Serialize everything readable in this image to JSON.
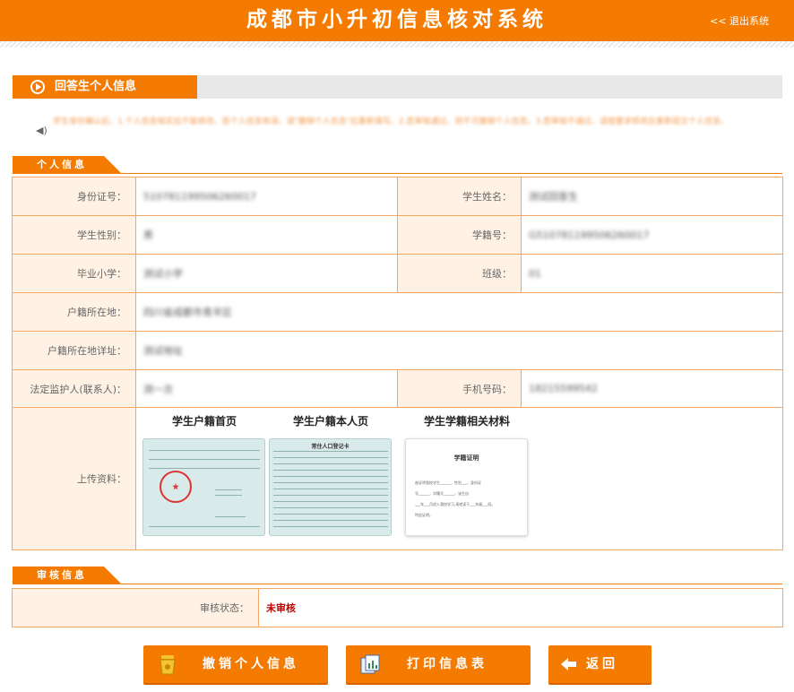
{
  "header": {
    "title": "成都市小升初信息核对系统",
    "logout": "<< 退出系统"
  },
  "section": {
    "title": "回答生个人信息"
  },
  "notice": {
    "text": "学生身份确认后，1.个人信息核实后不能修改，若个人信息有误，请\"撤销个人信息\"后重新填写。2.若审核通过，则不可撤销个人信息。3.若审核不通过，请按要求修改后重新提交个人信息。"
  },
  "personal": {
    "heading": "个人信息",
    "labels": {
      "id_number": "身份证号：",
      "student_name": "学生姓名：",
      "gender": "学生性别：",
      "student_no": "学籍号：",
      "primary_school": "毕业小学：",
      "class": "班级：",
      "household_location": "户籍所在地：",
      "household_address": "户籍所在地详址：",
      "guardian": "法定监护人(联系人)：",
      "phone": "手机号码：",
      "uploads": "上传资料："
    },
    "values": {
      "id_number": "510781199506260017",
      "student_name": "测试回答生",
      "gender": "男",
      "student_no": "G510781199506260017",
      "primary_school": "测试小学",
      "class": "01",
      "household_location": "四川省成都市青羊区",
      "household_address": "测试地址",
      "guardian": "测一次",
      "phone": "18215599542"
    }
  },
  "uploads": [
    {
      "title": "学生户籍首页"
    },
    {
      "title": "学生户籍本人页",
      "doc_title": "常住人口登记卡"
    },
    {
      "title": "学生学籍相关材料",
      "doc_title": "学籍证明",
      "doc_lines": [
        "兹证明我校学生______，性别___，身份证",
        "号______，学籍号______，该生自",
        "___年___月进入我校学习,现就读于___年级___班。",
        "特此证明。"
      ]
    }
  ],
  "audit": {
    "heading": "审核信息",
    "status_label": "审核状态：",
    "status_value": "未审核"
  },
  "buttons": {
    "revoke": "撤销个人信息",
    "print": "打印信息表",
    "back": "返回"
  },
  "colors": {
    "brand_orange": "#f57a00",
    "label_bg": "#fff2e5",
    "border": "#f5a660",
    "status_red": "#c00000"
  }
}
